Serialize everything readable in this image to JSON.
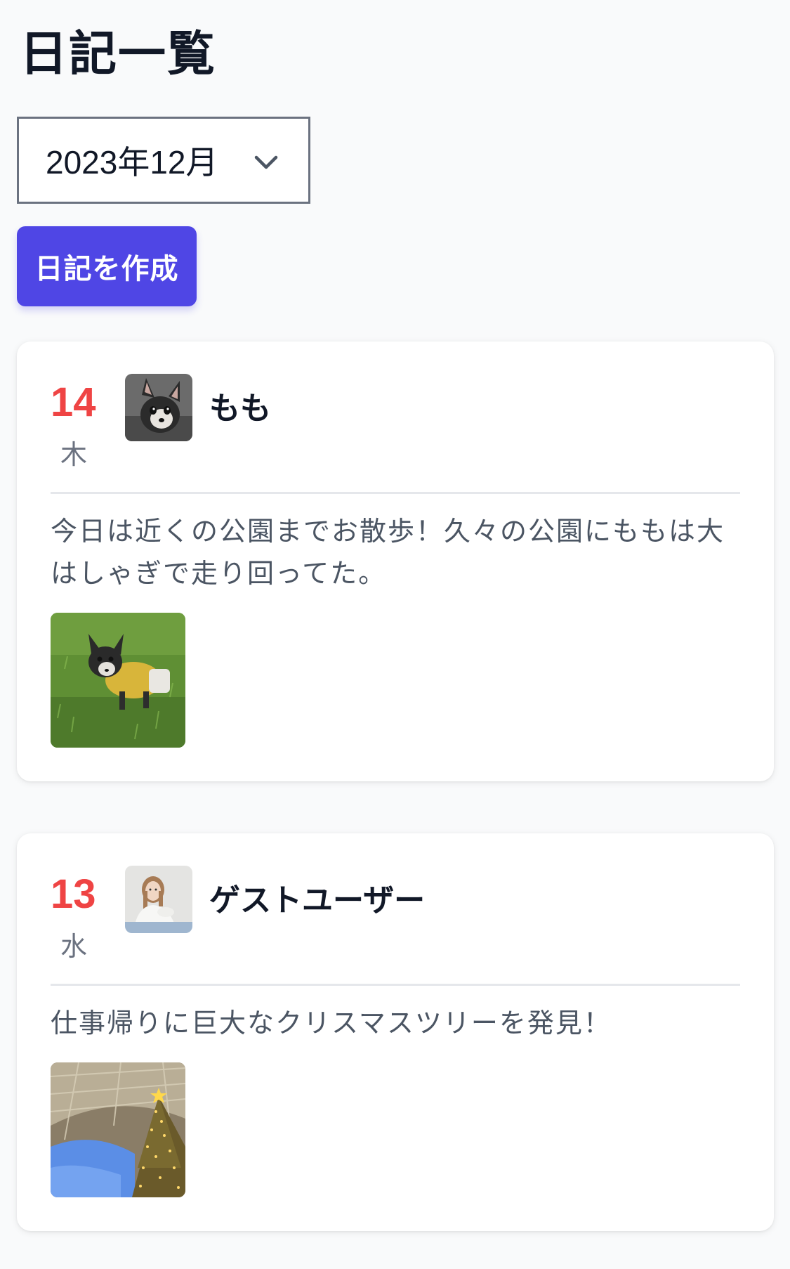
{
  "page": {
    "title": "日記一覧"
  },
  "filter": {
    "month_selected": "2023年12月"
  },
  "actions": {
    "create_label": "日記を作成"
  },
  "colors": {
    "accent": "#4f46e5",
    "date_red": "#ef4444",
    "muted_text": "#6b7280"
  },
  "entries": [
    {
      "day": "14",
      "weekday": "木",
      "author": "もも",
      "avatar_icon": "chihuahua-avatar",
      "text": "今日は近くの公園までお散歩！久々の公園にももは大はしゃぎで走り回ってた。",
      "photo_icon": "dog-on-grass-photo"
    },
    {
      "day": "13",
      "weekday": "水",
      "author": "ゲストユーザー",
      "avatar_icon": "woman-avatar",
      "text": "仕事帰りに巨大なクリスマスツリーを発見！",
      "photo_icon": "christmas-tree-photo"
    }
  ]
}
